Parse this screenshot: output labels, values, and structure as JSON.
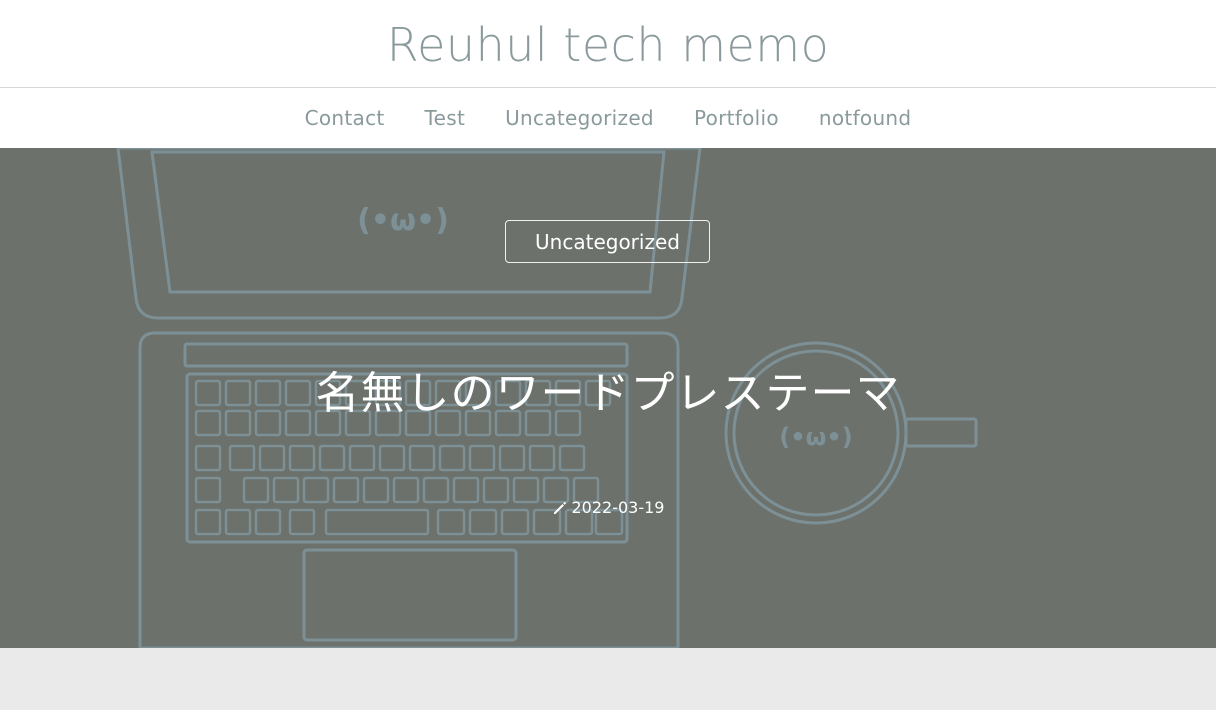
{
  "site": {
    "title": "Reuhul tech memo"
  },
  "nav": {
    "items": [
      "Contact",
      "Test",
      "Uncategorized",
      "Portfolio",
      "notfound"
    ]
  },
  "hero": {
    "category": "Uncategorized",
    "title": "名無しのワードプレステーマ",
    "date": "2022-03-19",
    "date_icon": "pencil-icon",
    "face_text": "(•ω•)"
  },
  "colors": {
    "hero_bg": "#6c716c",
    "line_art": "#7c9096",
    "text_muted": "#8a9a9c"
  }
}
